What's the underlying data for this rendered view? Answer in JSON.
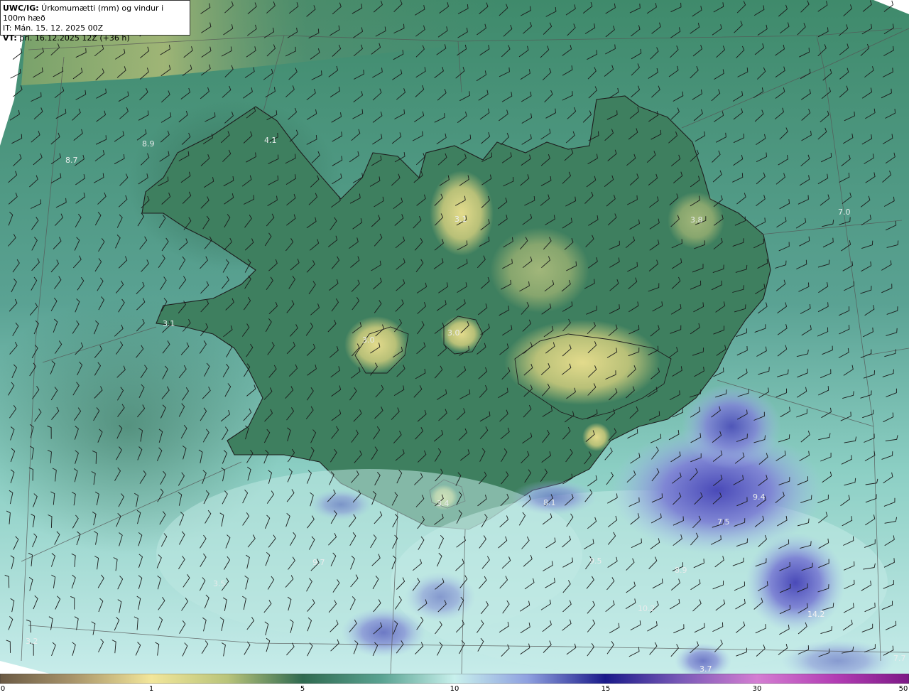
{
  "header": {
    "line1_bold": "UWC/IG:",
    "line1_text": " Úrkomumætti (mm) og vindur i 100m hæð",
    "line2": "IT: Mán. 15. 12. 2025 00Z",
    "line3_bold": "VT:",
    "line3_text": " þri. 16.12.2025 12Z (+36 h)"
  },
  "colorbar": {
    "ticks": [
      "0",
      "1",
      "5",
      "10",
      "15",
      "30",
      "50"
    ]
  },
  "value_labels": [
    "4.1",
    "3.1",
    "3.8",
    "7.0",
    "3.1",
    "3.0",
    "3.0",
    "3.4",
    "14.2",
    "3.7",
    "9.4",
    "7.5",
    "8.7",
    "3.2",
    "3.5",
    "9.7",
    "9.5",
    "8.9",
    "10.2",
    "8.1",
    "7.7",
    "8.9"
  ],
  "colors": {
    "green_dark": "#2f6b52",
    "green_mid": "#3f8a68",
    "teal": "#5aa89a",
    "yellow": "#d7d48a",
    "light_cyan": "#bfe6e0",
    "blue": "#6a73c9",
    "blue_dark": "#3a3aa8"
  }
}
